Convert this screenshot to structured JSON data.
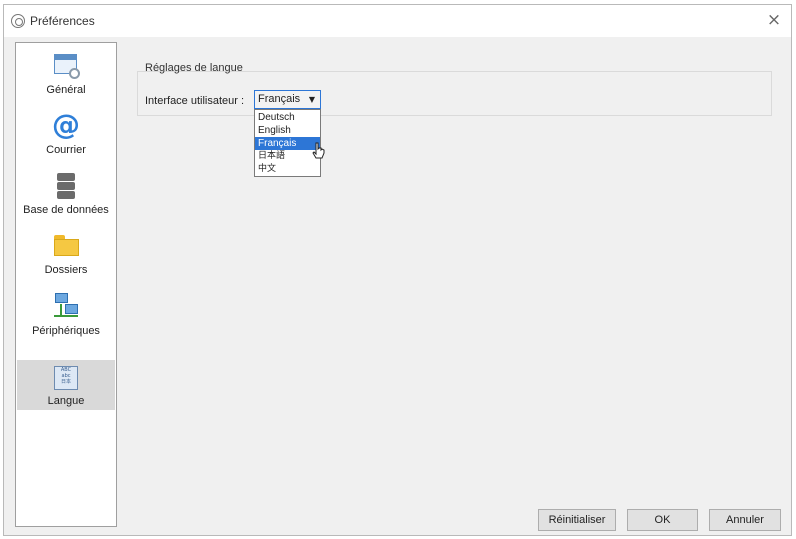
{
  "window": {
    "title": "Préférences",
    "close_symbol": "×"
  },
  "sidebar": {
    "items": [
      {
        "label": "Général",
        "icon": "general-settings-icon",
        "selected": false
      },
      {
        "label": "Courrier",
        "icon": "at-mail-icon",
        "selected": false
      },
      {
        "label": "Base de données",
        "icon": "database-icon",
        "selected": false
      },
      {
        "label": "Dossiers",
        "icon": "folder-icon",
        "selected": false
      },
      {
        "label": "Périphériques",
        "icon": "network-devices-icon",
        "selected": false
      },
      {
        "label": "Langue",
        "icon": "language-icon",
        "selected": true
      }
    ]
  },
  "language_settings": {
    "group_title": "Réglages de langue",
    "field_label": "Interface utilisateur :",
    "selected_value": "Français",
    "options": [
      "Deutsch",
      "English",
      "Français",
      "日本語",
      "中文"
    ],
    "highlighted_option": "Français"
  },
  "footer": {
    "reset_label": "Réinitialiser",
    "ok_label": "OK",
    "cancel_label": "Annuler"
  },
  "colors": {
    "accent": "#2d76d6",
    "selected_sidebar": "#d9d9d9"
  }
}
